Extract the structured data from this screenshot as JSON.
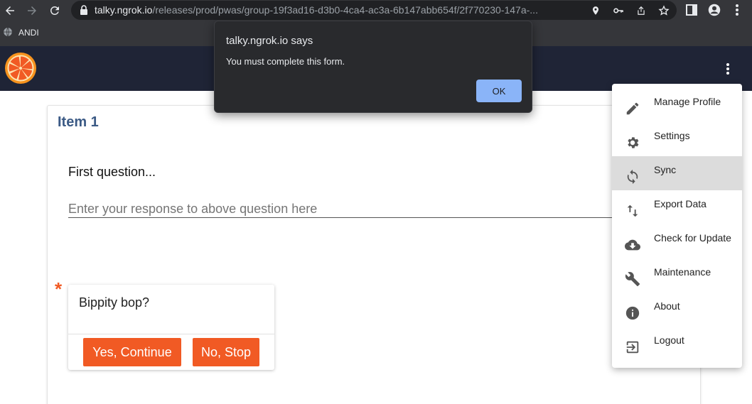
{
  "browser": {
    "url_host": "talky.ngrok.io",
    "url_path": "/releases/prod/pwas/group-19f3ad16-d3b0-4ca4-ac3a-6b147abb654f/2f770230-147a-...",
    "bookmark": "ANDI",
    "icons": [
      "back-icon",
      "forward-icon",
      "reload-icon",
      "lock-icon",
      "location-icon",
      "key-icon",
      "share-icon",
      "star-icon",
      "side-panel-icon",
      "profile-icon",
      "more-icon"
    ]
  },
  "alert": {
    "title": "talky.ngrok.io says",
    "message": "You must complete this form.",
    "ok": "OK"
  },
  "form": {
    "item_title": "Item 1",
    "question1": "First question...",
    "response_placeholder": "Enter your response to above question here",
    "required_marker": "*",
    "question2": "Bippity bop?",
    "yes_button": "Yes, Continue",
    "no_button": "No, Stop"
  },
  "menu": {
    "items": [
      {
        "label": "Manage Profile",
        "icon": "pencil-icon"
      },
      {
        "label": "Settings",
        "icon": "gear-icon"
      },
      {
        "label": "Sync",
        "icon": "sync-icon",
        "active": true
      },
      {
        "label": "Export Data",
        "icon": "swap-vertical-icon"
      },
      {
        "label": "Check for Update",
        "icon": "cloud-download-icon"
      },
      {
        "label": "Maintenance",
        "icon": "wrench-icon"
      },
      {
        "label": "About",
        "icon": "info-icon"
      },
      {
        "label": "Logout",
        "icon": "logout-icon"
      }
    ]
  },
  "colors": {
    "appbar": "#1f2436",
    "accent": "#f15a24",
    "title": "#3b5a85",
    "alert_button": "#8ab4f8"
  }
}
